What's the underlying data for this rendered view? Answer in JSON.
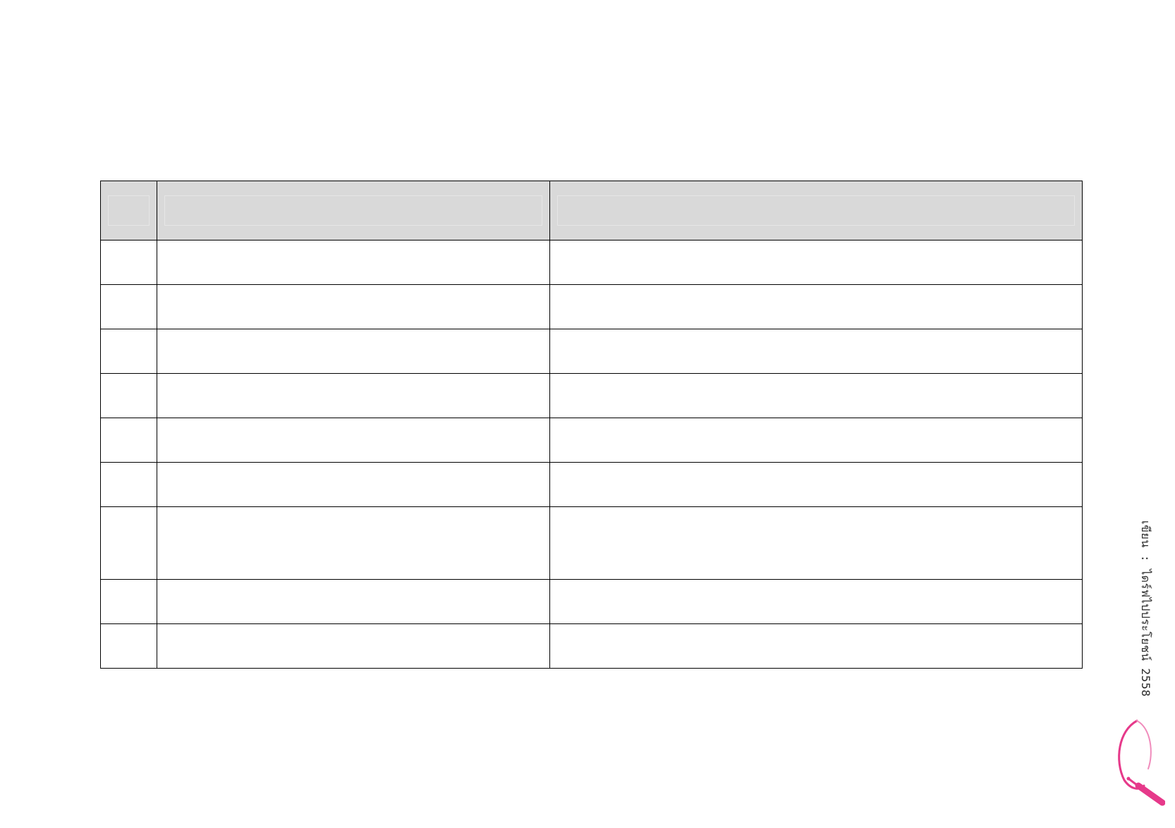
{
  "table": {
    "headers": [
      "",
      "",
      ""
    ],
    "rows": [
      [
        "",
        "",
        ""
      ],
      [
        "",
        "",
        ""
      ],
      [
        "",
        "",
        ""
      ],
      [
        "",
        "",
        ""
      ],
      [
        "",
        "",
        ""
      ],
      [
        "",
        "",
        ""
      ],
      [
        "",
        "",
        ""
      ],
      [
        "",
        "",
        ""
      ],
      [
        "",
        "",
        ""
      ]
    ]
  },
  "side_caption": "เขียน : ไดร์ฟไปประโยชน์ 2558",
  "decoration": {
    "icon": "pen-swoosh-icon",
    "colors": {
      "header_fill": "#d9d9d9",
      "grid_line": "#000000",
      "pen_pink": "#e6398a"
    }
  }
}
